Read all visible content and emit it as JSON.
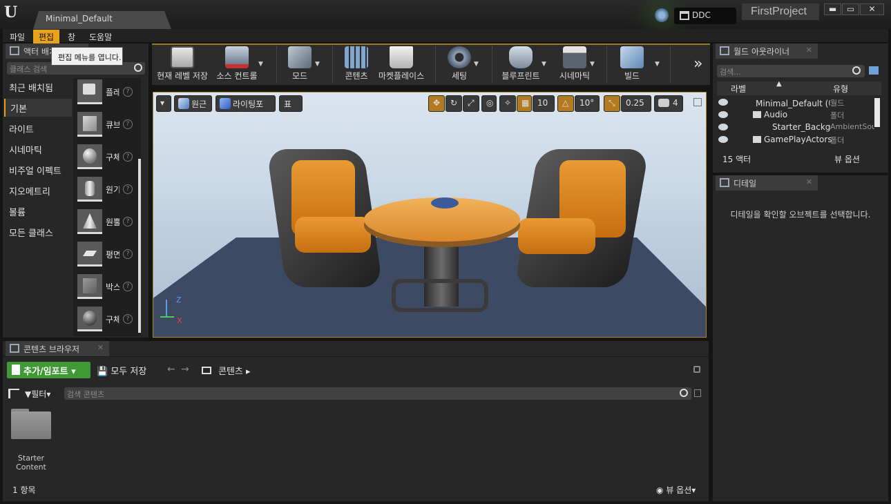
{
  "window": {
    "doc_tab": "Minimal_Default",
    "ddc": "DDC",
    "project_name": "FirstProject",
    "min": "▬",
    "max": "▭",
    "close": "✕"
  },
  "menu": {
    "items": [
      "파일",
      "편집",
      "창",
      "도움말"
    ],
    "tooltip": "편집 메뉴를 엽니다."
  },
  "place_actors": {
    "tab": "액터 배치",
    "search_placeholder": "클래스 검색",
    "categories": [
      "최근 배치됨",
      "기본",
      "라이트",
      "시네마틱",
      "비주얼 이펙트",
      "지오메트리",
      "볼륨",
      "모든 클래스"
    ],
    "selected_category": "기본",
    "items": [
      "플레이어 스타트",
      "큐브",
      "구체",
      "원기둥",
      "원뿔",
      "평면",
      "박스 트리거",
      "구체 트리거"
    ]
  },
  "toolbar": {
    "buttons": [
      "현재 레벨 저장",
      "소스 컨트롤",
      "모드",
      "콘텐츠",
      "마켓플레이스",
      "세팅",
      "블루프린트",
      "시네마틱",
      "빌드"
    ],
    "more": "»"
  },
  "viewport": {
    "perspective": "원근",
    "lit": "라이팅포함",
    "show": "표시",
    "grid_snap": "10",
    "rotation_snap": "10°",
    "scale_snap": "0.25",
    "camera_speed": "4",
    "axis_z": "Z",
    "axis_x": "X"
  },
  "outliner": {
    "tab": "월드 아웃라이너",
    "search_placeholder": "검색...",
    "col_label": "라벨",
    "col_type": "유형",
    "rows": [
      {
        "label": "Minimal_Default (에디터)",
        "type": "월드"
      },
      {
        "label": "Audio",
        "type": "폴더"
      },
      {
        "label": "Starter_Background_Cue",
        "type": "AmbientSound"
      },
      {
        "label": "GamePlayActors",
        "type": "폴더"
      }
    ],
    "actor_count": "15 액터",
    "view_options": "뷰 옵션"
  },
  "details": {
    "tab": "디테일",
    "message": "디테일을 확인할 오브젝트를 선택합니다."
  },
  "content_browser": {
    "tab": "콘텐츠 브라우저",
    "add_import": "추가/임포트",
    "save_all": "모두 저장",
    "path": "콘텐츠",
    "filter": "필터",
    "search_placeholder": "검색 콘텐츠",
    "folder_label": "Starter Content",
    "item_count": "1 항목",
    "view_options": "뷰 옵션"
  },
  "colors": {
    "accent": "#e8a21c",
    "add_button": "#3f9a35",
    "viewport_border": "#b08a2a"
  }
}
